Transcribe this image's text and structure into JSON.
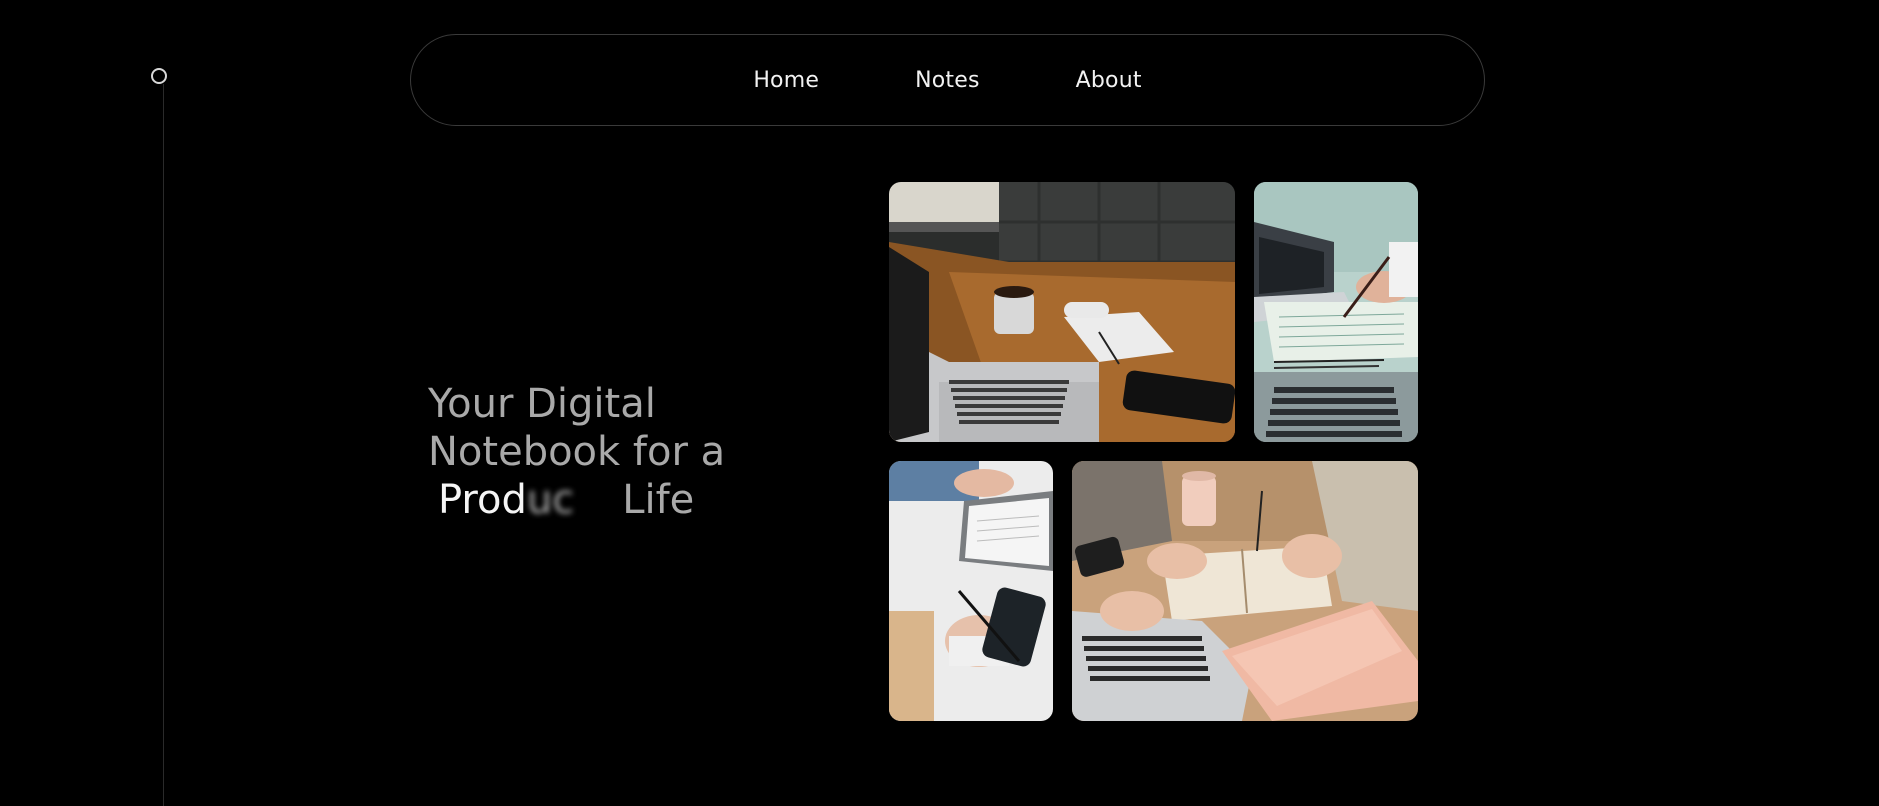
{
  "nav": {
    "items": [
      {
        "label": "Home"
      },
      {
        "label": "Notes"
      },
      {
        "label": "About"
      }
    ]
  },
  "hero": {
    "line1": "Your Digital",
    "line2": "Notebook for a",
    "word_strong": "Prod",
    "word_fade": "uc",
    "word_end": "Life"
  },
  "photos": [
    {
      "subject": "laptop-coffee-notepad-desk"
    },
    {
      "subject": "hand-writing-notes-laptop"
    },
    {
      "subject": "hands-notebook-phone"
    },
    {
      "subject": "two-people-laptop-notebook"
    }
  ],
  "colors": {
    "background": "#000000",
    "nav_border": "#3a3a3a",
    "text_primary": "#f2f2f2",
    "text_muted": "#a9a9a9"
  }
}
